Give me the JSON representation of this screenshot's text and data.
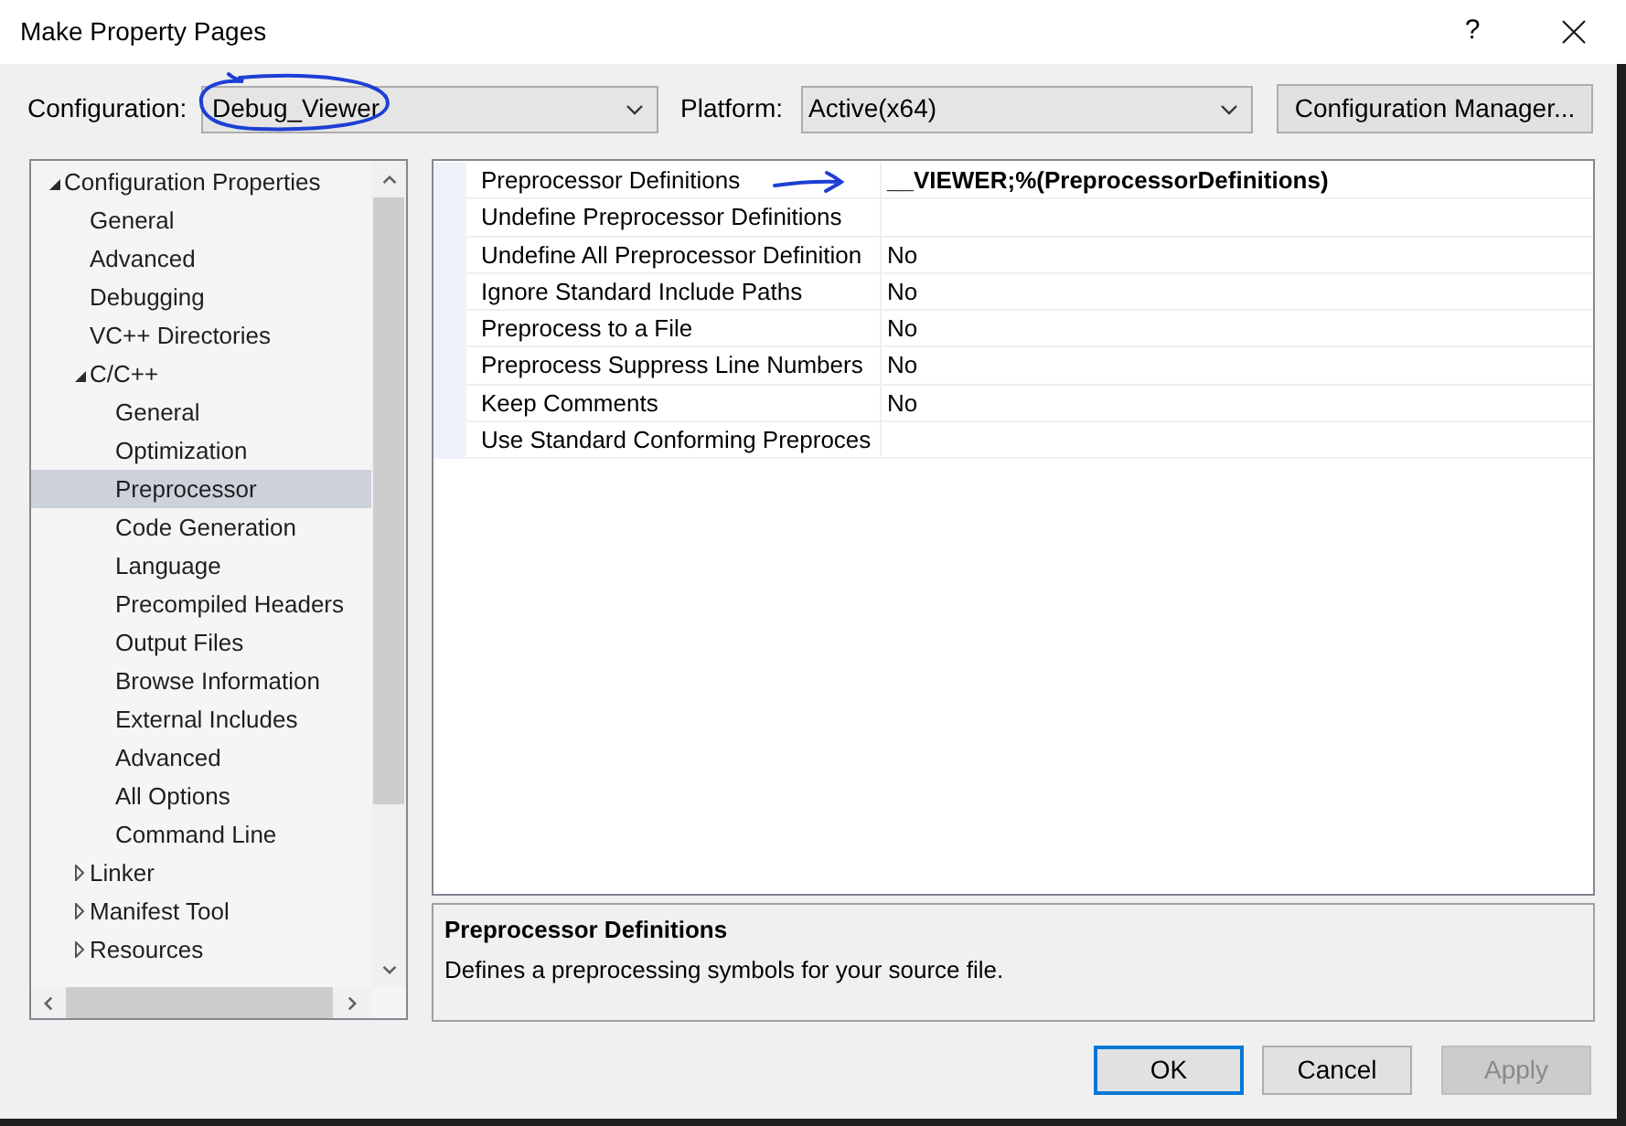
{
  "window": {
    "title": "Make Property Pages",
    "help_button": "?"
  },
  "configuration": {
    "label": "Configuration:",
    "value": "Debug_Viewer"
  },
  "platform": {
    "label": "Platform:",
    "value": "Active(x64)"
  },
  "configuration_manager_button": "Configuration Manager...",
  "tree": {
    "items": [
      {
        "label": "Configuration Properties",
        "kind": "group",
        "expanded": true,
        "selected": false,
        "children": [
          {
            "label": "General",
            "kind": "page",
            "selected": false
          },
          {
            "label": "Advanced",
            "kind": "page",
            "selected": false
          },
          {
            "label": "Debugging",
            "kind": "page",
            "selected": false
          },
          {
            "label": "VC++ Directories",
            "kind": "page",
            "selected": false
          },
          {
            "label": "C/C++",
            "kind": "group",
            "expanded": true,
            "selected": false,
            "children": [
              {
                "label": "General",
                "kind": "page",
                "selected": false
              },
              {
                "label": "Optimization",
                "kind": "page",
                "selected": false
              },
              {
                "label": "Preprocessor",
                "kind": "page",
                "selected": true
              },
              {
                "label": "Code Generation",
                "kind": "page",
                "selected": false
              },
              {
                "label": "Language",
                "kind": "page",
                "selected": false
              },
              {
                "label": "Precompiled Headers",
                "kind": "page",
                "selected": false
              },
              {
                "label": "Output Files",
                "kind": "page",
                "selected": false
              },
              {
                "label": "Browse Information",
                "kind": "page",
                "selected": false
              },
              {
                "label": "External Includes",
                "kind": "page",
                "selected": false
              },
              {
                "label": "Advanced",
                "kind": "page",
                "selected": false
              },
              {
                "label": "All Options",
                "kind": "page",
                "selected": false
              },
              {
                "label": "Command Line",
                "kind": "page",
                "selected": false
              }
            ]
          },
          {
            "label": "Linker",
            "kind": "group",
            "expanded": false,
            "selected": false
          },
          {
            "label": "Manifest Tool",
            "kind": "group",
            "expanded": false,
            "selected": false
          },
          {
            "label": "Resources",
            "kind": "group",
            "expanded": false,
            "selected": false
          }
        ]
      }
    ]
  },
  "property_grid": {
    "rows": [
      {
        "name": "Preprocessor Definitions",
        "value": "__VIEWER;%(PreprocessorDefinitions)",
        "modified": true
      },
      {
        "name": "Undefine Preprocessor Definitions"
      },
      {
        "name": "Undefine All Preprocessor Definition",
        "value": "No",
        "modified": false
      },
      {
        "name": "Ignore Standard Include Paths",
        "value": "No",
        "modified": false
      },
      {
        "name": "Preprocess to a File",
        "value": "No",
        "modified": false
      },
      {
        "name": "Preprocess Suppress Line Numbers",
        "value": "No",
        "modified": false
      },
      {
        "name": "Keep Comments",
        "value": "No",
        "modified": false
      },
      {
        "name": "Use Standard Conforming Preproces"
      }
    ]
  },
  "description": {
    "title": "Preprocessor Definitions",
    "text": "Defines a preprocessing symbols for your source file."
  },
  "buttons": [
    {
      "label": "OK",
      "default": true,
      "disabled": false
    },
    {
      "label": "Cancel",
      "default": false,
      "disabled": false
    },
    {
      "label": "Apply",
      "default": false,
      "disabled": true
    }
  ]
}
